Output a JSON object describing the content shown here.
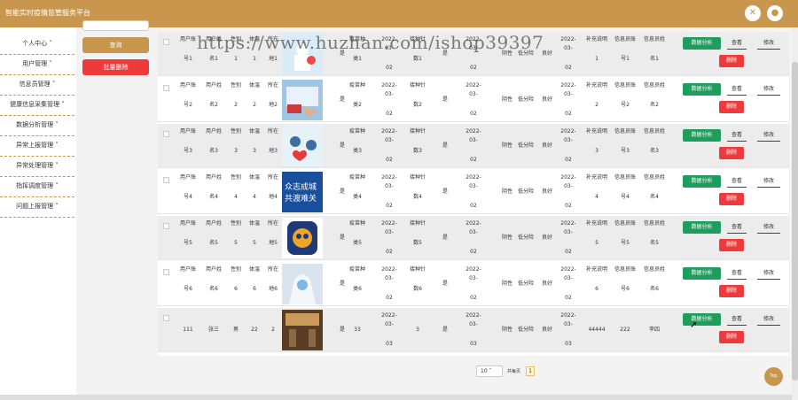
{
  "app": {
    "title": "智能实时疫情监管服务平台"
  },
  "watermark": "https://www.huzhan.com/ishop39397",
  "icons": {
    "share": "cross-arrows-icon",
    "user": "user-icon"
  },
  "menu": [
    "个人中心 ˅",
    "用户管理 ˅",
    "信息员管理 ˅",
    "健康信息采集管理 ˅",
    "数据分析管理 ˅",
    "异常上报管理 ˅",
    "异常处理管理 ˅",
    "指挥调度管理 ˅",
    "问题上报管理 ˅"
  ],
  "actions": {
    "query": "查询",
    "batch_delete": "批量删除"
  },
  "row_buttons": {
    "analysis": "数据分析",
    "view": "查看",
    "edit": "修改",
    "delete": "删除"
  },
  "rows": [
    {
      "c": [
        [
          "用户账",
          "号1"
        ],
        [
          "用户姓",
          "名1"
        ],
        [
          "性别",
          "1"
        ],
        [
          "体温",
          "1"
        ],
        [
          "所在",
          "地1"
        ],
        [
          "是"
        ],
        [
          "疫苗种",
          "类1"
        ],
        [
          "2022-03-",
          "02"
        ],
        [
          "接种针",
          "数1"
        ],
        [
          "是"
        ],
        [
          "2022-03-",
          "02"
        ],
        [
          "阴性"
        ],
        [
          "低分险"
        ],
        [
          "良好"
        ],
        [
          "2022-03-",
          "02"
        ],
        [
          "补充说明",
          "1"
        ],
        [
          "信息员账",
          "号1"
        ],
        [
          "信息员姓",
          "名1"
        ]
      ]
    },
    {
      "c": [
        [
          "用户账",
          "号2"
        ],
        [
          "用户姓",
          "名2"
        ],
        [
          "性别",
          "2"
        ],
        [
          "体温",
          "2"
        ],
        [
          "所在",
          "地2"
        ],
        [
          "是"
        ],
        [
          "疫苗种",
          "类2"
        ],
        [
          "2022-03-",
          "02"
        ],
        [
          "接种针",
          "数2"
        ],
        [
          "是"
        ],
        [
          "2022-03-",
          "02"
        ],
        [
          "阴性"
        ],
        [
          "低分险"
        ],
        [
          "良好"
        ],
        [
          "2022-03-",
          "02"
        ],
        [
          "补充说明",
          "2"
        ],
        [
          "信息员账",
          "号2"
        ],
        [
          "信息员姓",
          "名2"
        ]
      ]
    },
    {
      "c": [
        [
          "用户账",
          "号3"
        ],
        [
          "用户姓",
          "名3"
        ],
        [
          "性别",
          "3"
        ],
        [
          "体温",
          "3"
        ],
        [
          "所在",
          "地3"
        ],
        [
          "是"
        ],
        [
          "疫苗种",
          "类3"
        ],
        [
          "2022-03-",
          "02"
        ],
        [
          "接种针",
          "数3"
        ],
        [
          "是"
        ],
        [
          "2022-03-",
          "02"
        ],
        [
          "阴性"
        ],
        [
          "低分险"
        ],
        [
          "良好"
        ],
        [
          "2022-03-",
          "02"
        ],
        [
          "补充说明",
          "3"
        ],
        [
          "信息员账",
          "号3"
        ],
        [
          "信息员姓",
          "名3"
        ]
      ]
    },
    {
      "c": [
        [
          "用户账",
          "号4"
        ],
        [
          "用户姓",
          "名4"
        ],
        [
          "性别",
          "4"
        ],
        [
          "体温",
          "4"
        ],
        [
          "所在",
          "地4"
        ],
        [
          "是"
        ],
        [
          "疫苗种",
          "类4"
        ],
        [
          "2022-03-",
          "02"
        ],
        [
          "接种针",
          "数4"
        ],
        [
          "是"
        ],
        [
          "2022-03-",
          "02"
        ],
        [
          "阴性"
        ],
        [
          "低分险"
        ],
        [
          "良好"
        ],
        [
          "2022-03-",
          "02"
        ],
        [
          "补充说明",
          "4"
        ],
        [
          "信息员账",
          "号4"
        ],
        [
          "信息员姓",
          "名4"
        ]
      ]
    },
    {
      "c": [
        [
          "用户账",
          "号5"
        ],
        [
          "用户姓",
          "名5"
        ],
        [
          "性别",
          "5"
        ],
        [
          "体温",
          "5"
        ],
        [
          "所在",
          "地5"
        ],
        [
          "是"
        ],
        [
          "疫苗种",
          "类5"
        ],
        [
          "2022-03-",
          "02"
        ],
        [
          "接种针",
          "数5"
        ],
        [
          "是"
        ],
        [
          "2022-03-",
          "02"
        ],
        [
          "阴性"
        ],
        [
          "低分险"
        ],
        [
          "良好"
        ],
        [
          "2022-03-",
          "02"
        ],
        [
          "补充说明",
          "5"
        ],
        [
          "信息员账",
          "号5"
        ],
        [
          "信息员姓",
          "名5"
        ]
      ]
    },
    {
      "c": [
        [
          "用户账",
          "号6"
        ],
        [
          "用户姓",
          "名6"
        ],
        [
          "性别",
          "6"
        ],
        [
          "体温",
          "6"
        ],
        [
          "所在",
          "地6"
        ],
        [
          "是"
        ],
        [
          "疫苗种",
          "类6"
        ],
        [
          "2022-03-",
          "02"
        ],
        [
          "接种针",
          "数6"
        ],
        [
          "是"
        ],
        [
          "2022-03-",
          "02"
        ],
        [
          "阴性"
        ],
        [
          "低分险"
        ],
        [
          "良好"
        ],
        [
          "2022-03-",
          "02"
        ],
        [
          "补充说明",
          "6"
        ],
        [
          "信息员账",
          "号6"
        ],
        [
          "信息员姓",
          "名6"
        ]
      ]
    },
    {
      "c": [
        [
          "111"
        ],
        [
          "张三"
        ],
        [
          "男"
        ],
        [
          "22"
        ],
        [
          "2"
        ],
        [
          "是"
        ],
        [
          "33"
        ],
        [
          "2022-03-",
          "03"
        ],
        [
          "3"
        ],
        [
          "是"
        ],
        [
          "2022-03-",
          "03"
        ],
        [
          "阴性"
        ],
        [
          "低分险"
        ],
        [
          "良好"
        ],
        [
          "2022-03-",
          "03"
        ],
        [
          "44444"
        ],
        [
          "222"
        ],
        [
          "李四"
        ]
      ]
    }
  ],
  "image_captions": {
    "r4": "众志成城 共渡难关"
  },
  "pagination": {
    "page_size": "10",
    "label": "共每页",
    "current": "1"
  },
  "top_button": "Top",
  "colors": {
    "header": "#c8964c",
    "green": "#1e9e5c",
    "red": "#ee3a3a"
  }
}
